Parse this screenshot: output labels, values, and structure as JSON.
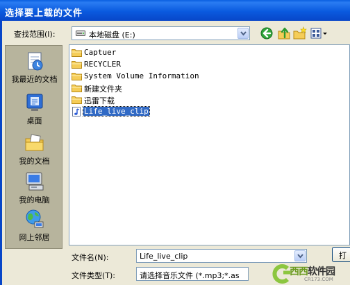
{
  "window": {
    "title": "选择要上载的文件"
  },
  "look_in": {
    "label": "查找范围(I):",
    "value": "本地磁盘 (E:)"
  },
  "places": [
    {
      "label": "我最近的文档",
      "icon": "recent-documents-icon"
    },
    {
      "label": "桌面",
      "icon": "desktop-icon"
    },
    {
      "label": "我的文档",
      "icon": "my-documents-icon"
    },
    {
      "label": "我的电脑",
      "icon": "my-computer-icon"
    },
    {
      "label": "网上邻居",
      "icon": "network-places-icon"
    }
  ],
  "files": [
    {
      "name": "Captuer",
      "type": "folder"
    },
    {
      "name": "RECYCLER",
      "type": "folder"
    },
    {
      "name": "System Volume Information",
      "type": "folder"
    },
    {
      "name": "新建文件夹",
      "type": "folder"
    },
    {
      "name": "迅雷下载",
      "type": "folder"
    },
    {
      "name": "Life_live_clip",
      "type": "audio",
      "selected": true
    }
  ],
  "filename": {
    "label": "文件名(N):",
    "value": "Life_live_clip"
  },
  "filetype": {
    "label": "文件类型(T):",
    "value": "请选择音乐文件 (*.mp3;*.as"
  },
  "buttons": {
    "open": "打"
  },
  "watermark": {
    "name_green": "西西",
    "name_dark": "软件园",
    "url": "CR173.COM"
  },
  "colors": {
    "title_bar": "#0a5adf",
    "selection": "#316ac5",
    "dialog_bg": "#ece9d8"
  }
}
